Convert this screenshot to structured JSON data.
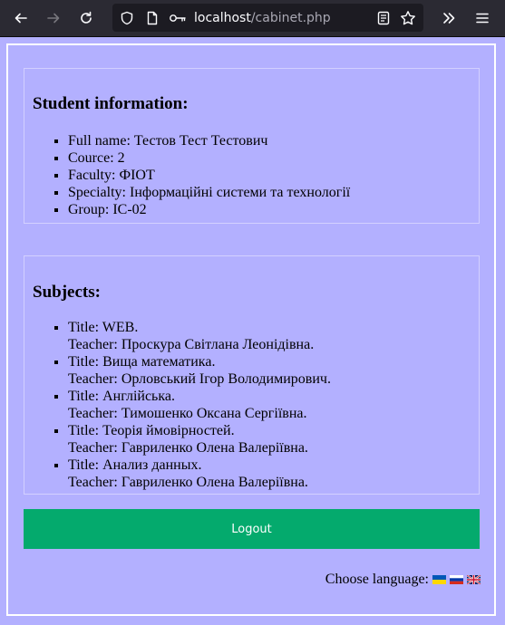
{
  "browser": {
    "url_host": "localhost",
    "url_path": "/cabinet.php"
  },
  "student": {
    "heading": "Student information:",
    "items": [
      "Full name: Тестов Тест Тестович",
      "Cource: 2",
      "Faculty: ФІОТ",
      "Specialty: Інформаційні системи та технології",
      "Group: ІС-02"
    ]
  },
  "subjects": {
    "heading": "Subjects:",
    "items": [
      {
        "title": "Title: WEB.",
        "teacher": "Teacher: Проскура Світлана Леонідівна."
      },
      {
        "title": "Title: Вища математика.",
        "teacher": "Teacher: Орловський Ігор Володимирович."
      },
      {
        "title": "Title: Англійська.",
        "teacher": "Teacher: Тимошенко Оксана Сергіївна."
      },
      {
        "title": "Title: Теорія ймовірностей.",
        "teacher": "Teacher: Гавриленко Олена Валеріївна."
      },
      {
        "title": "Title: Анализ данных.",
        "teacher": "Teacher: Гавриленко Олена Валеріївна."
      }
    ]
  },
  "logout_label": "Logout",
  "language": {
    "label": "Choose language:",
    "flags": [
      "ukraine-flag-icon",
      "russia-flag-icon",
      "uk-flag-icon"
    ]
  },
  "colors": {
    "page_bg": "#b3b0ff",
    "button_bg": "#04aa6d",
    "toolbar_bg": "#2b2a33"
  }
}
